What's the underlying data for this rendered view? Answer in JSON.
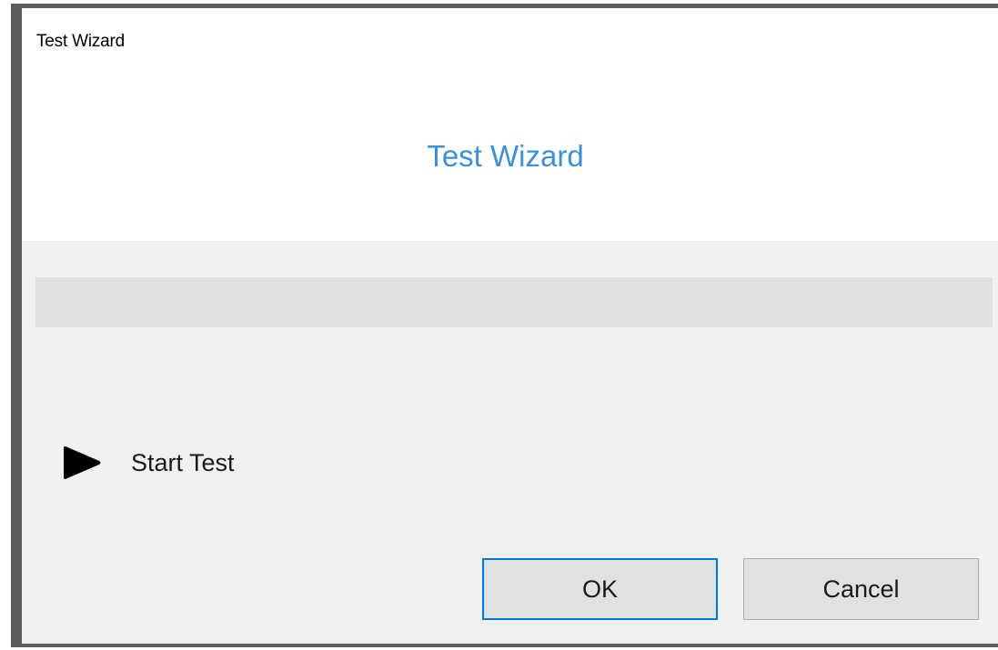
{
  "window": {
    "title": "Test Wizard"
  },
  "header": {
    "title": "Test Wizard",
    "title_color": "#3d8fd7"
  },
  "progress": {
    "value": 0
  },
  "step": {
    "icon": "play-icon",
    "label": "Start Test"
  },
  "buttons": {
    "ok_label": "OK",
    "cancel_label": "Cancel",
    "focus_color": "#0078d7"
  }
}
